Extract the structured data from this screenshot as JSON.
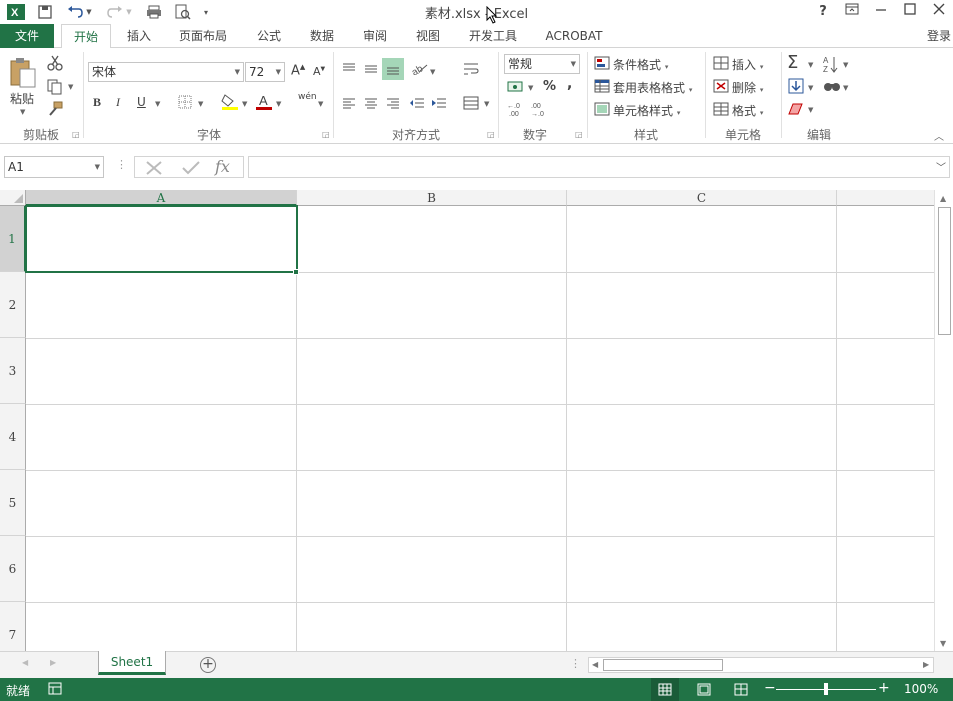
{
  "titlebar": {
    "title": "素材.xlsx - Excel",
    "icons": [
      "excel-logo-icon",
      "save-icon",
      "undo-icon",
      "redo-icon",
      "print-preview-icon",
      "quick-print-icon",
      "customize-qat-icon"
    ],
    "help": "?",
    "window_controls": [
      "ribbon-display-icon",
      "minimize-icon",
      "maximize-icon",
      "close-icon"
    ]
  },
  "tabs": {
    "file": "文件",
    "items": [
      "开始",
      "插入",
      "页面布局",
      "公式",
      "数据",
      "审阅",
      "视图",
      "开发工具",
      "ACROBAT"
    ],
    "login": "登录"
  },
  "ribbon": {
    "clipboard": {
      "paste": "粘贴",
      "label": "剪贴板"
    },
    "font": {
      "name": "宋体",
      "size": "72",
      "bold": "B",
      "italic": "I",
      "underline": "U",
      "phonetic": "wén",
      "label": "字体"
    },
    "alignment": {
      "label": "对齐方式"
    },
    "number": {
      "format": "常规",
      "percent": "%",
      "comma": ",",
      "label": "数字"
    },
    "styles": {
      "conditional": "条件格式",
      "table": "套用表格格式",
      "cell": "单元格样式",
      "label": "样式"
    },
    "cells": {
      "insert": "插入",
      "delete": "删除",
      "format": "格式",
      "label": "单元格"
    },
    "editing": {
      "label": "编辑"
    }
  },
  "formula_bar": {
    "name_box": "A1",
    "fx": "fx",
    "value": ""
  },
  "grid": {
    "columns": [
      "A",
      "B",
      "C"
    ],
    "rows": [
      "1",
      "2",
      "3",
      "4",
      "5",
      "6",
      "7"
    ],
    "selected": "A1"
  },
  "sheets": {
    "tabs": [
      "Sheet1"
    ],
    "active": "Sheet1"
  },
  "status": {
    "mode": "就绪",
    "zoom": "100%",
    "zoom_level": 1.0
  },
  "colors": {
    "accent": "#217346",
    "header": "#f3f3f3",
    "gridline": "#d4d4d4"
  }
}
